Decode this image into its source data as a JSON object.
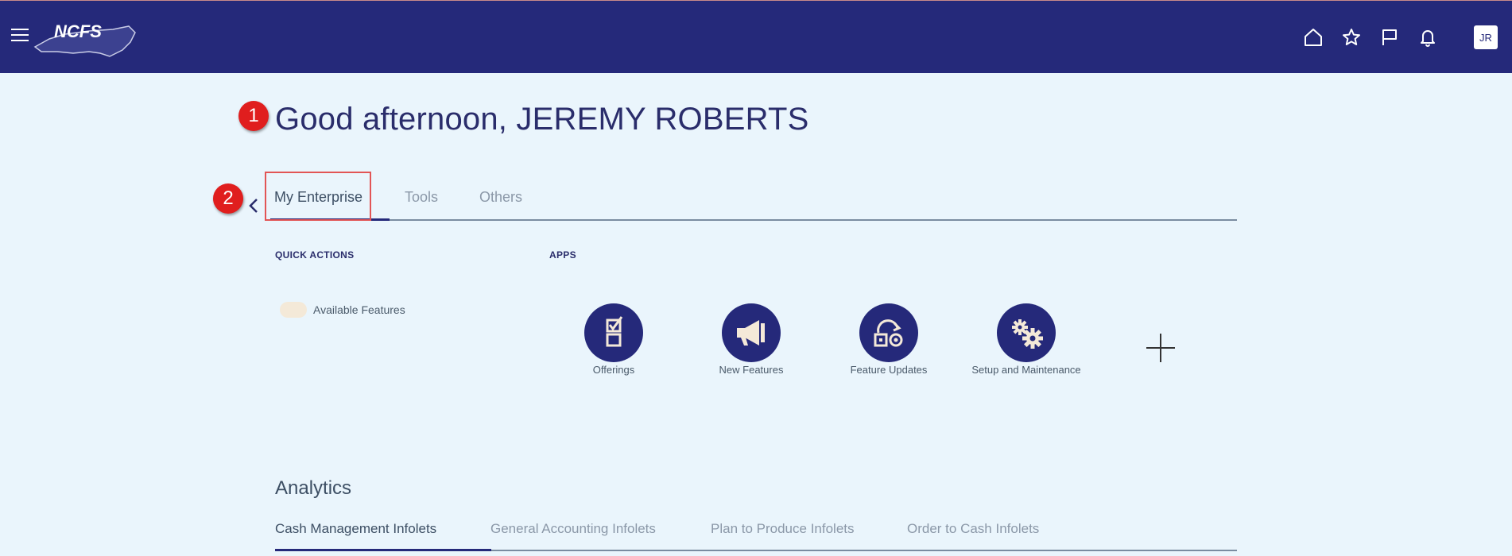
{
  "header": {
    "logo_text": "NCFS",
    "avatar_initials": "JR",
    "icons": [
      "menu-icon",
      "home-icon",
      "star-icon",
      "flag-icon",
      "bell-icon"
    ]
  },
  "greeting": "Good afternoon, JEREMY ROBERTS",
  "markers": [
    "1",
    "2"
  ],
  "tabs": [
    {
      "label": "My Enterprise",
      "active": true
    },
    {
      "label": "Tools",
      "active": false
    },
    {
      "label": "Others",
      "active": false
    }
  ],
  "quick_actions": {
    "title": "QUICK ACTIONS",
    "items": [
      {
        "label": "Available Features"
      }
    ]
  },
  "apps": {
    "title": "APPS",
    "items": [
      {
        "label": "Offerings",
        "icon": "offerings-icon"
      },
      {
        "label": "New Features",
        "icon": "megaphone-icon"
      },
      {
        "label": "Feature Updates",
        "icon": "feature-updates-icon"
      },
      {
        "label": "Setup and Maintenance",
        "icon": "gears-icon"
      }
    ]
  },
  "analytics": {
    "title": "Analytics",
    "tabs": [
      {
        "label": "Cash Management Infolets",
        "active": true
      },
      {
        "label": "General Accounting Infolets",
        "active": false
      },
      {
        "label": "Plan to Produce Infolets",
        "active": false
      },
      {
        "label": "Order to Cash Infolets",
        "active": false
      }
    ]
  },
  "colors": {
    "brand": "#25297a",
    "background": "#eaf5fc",
    "marker": "#e01e1e",
    "highlight": "#e25555"
  }
}
